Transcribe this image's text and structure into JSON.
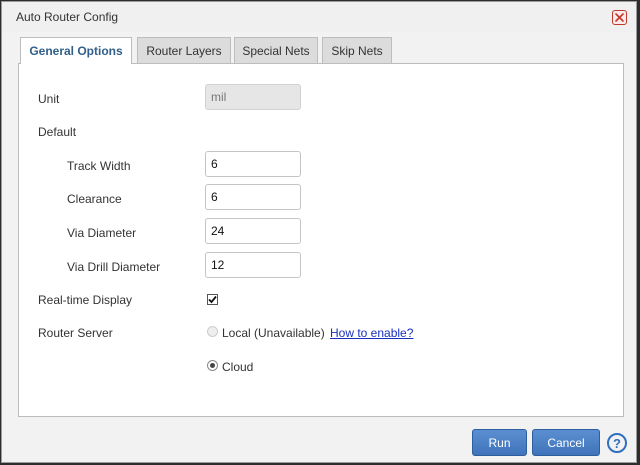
{
  "window": {
    "title": "Auto Router Config"
  },
  "tabs": [
    {
      "label": "General Options",
      "active": true
    },
    {
      "label": "Router Layers",
      "active": false
    },
    {
      "label": "Special Nets",
      "active": false
    },
    {
      "label": "Skip Nets",
      "active": false
    }
  ],
  "general": {
    "unit_label": "Unit",
    "unit_value": "mil",
    "default_label": "Default",
    "track_width_label": "Track Width",
    "track_width_value": "6",
    "clearance_label": "Clearance",
    "clearance_value": "6",
    "via_diameter_label": "Via Diameter",
    "via_diameter_value": "24",
    "via_drill_label": "Via Drill Diameter",
    "via_drill_value": "12",
    "realtime_label": "Real-time Display",
    "realtime_checked": true,
    "router_server_label": "Router Server",
    "local_label": "Local (Unavailable)",
    "how_to_enable_link": "How to enable?",
    "cloud_label": "Cloud",
    "selected_server": "Cloud"
  },
  "buttons": {
    "run": "Run",
    "cancel": "Cancel",
    "help": "?"
  },
  "colors": {
    "accent": "#3f74bb",
    "active_tab_text": "#2f5f8a",
    "close": "#c0392b",
    "link": "#1a2fbf"
  }
}
